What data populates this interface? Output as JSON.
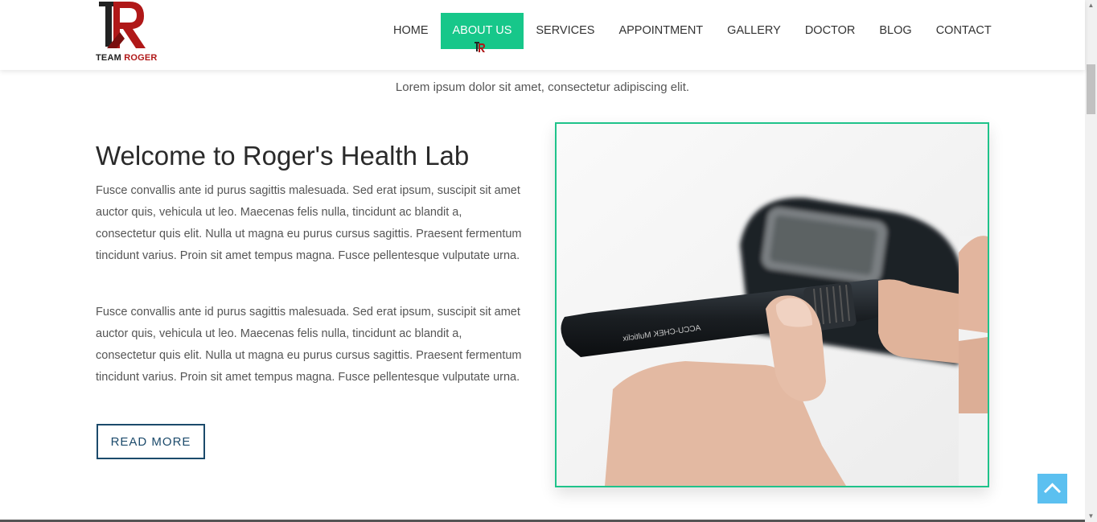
{
  "logo": {
    "text_team": "TEAM",
    "text_roger": "ROGER",
    "mark": "TR"
  },
  "nav": {
    "items": [
      {
        "label": "HOME",
        "active": false
      },
      {
        "label": "ABOUT US",
        "active": true
      },
      {
        "label": "SERVICES",
        "active": false
      },
      {
        "label": "APPOINTMENT",
        "active": false
      },
      {
        "label": "GALLERY",
        "active": false
      },
      {
        "label": "DOCTOR",
        "active": false
      },
      {
        "label": "BLOG",
        "active": false
      },
      {
        "label": "CONTACT",
        "active": false
      }
    ]
  },
  "main": {
    "subtitle": "Lorem ipsum dolor sit amet, consectetur adipiscing elit.",
    "title": "Welcome to Roger's Health Lab",
    "paragraph1": "Fusce convallis ante id purus sagittis malesuada. Sed erat ipsum, suscipit sit amet auctor quis, vehicula ut leo. Maecenas felis nulla, tincidunt ac blandit a, consectetur quis elit. Nulla ut magna eu purus cursus sagittis. Praesent fermentum tincidunt varius. Proin sit amet tempus magna. Fusce pellentesque vulputate urna.",
    "paragraph2": "Fusce convallis ante id purus sagittis malesuada. Sed erat ipsum, suscipit sit amet auctor quis, vehicula ut leo. Maecenas felis nulla, tincidunt ac blandit a, consectetur quis elit. Nulla ut magna eu purus cursus sagittis. Praesent fermentum tincidunt varius. Proin sit amet tempus magna. Fusce pellentesque vulputate urna.",
    "read_more_label": "READ MORE",
    "image_device_text": "ACCU-CHEK Multiclix"
  },
  "colors": {
    "accent_green": "#17c78a",
    "button_blue": "#1b4a6b",
    "back_to_top": "#5bc0f0",
    "logo_red": "#b01818"
  },
  "icons": {
    "back_to_top": "chevron-up-icon",
    "cursor": "logo-cursor-icon"
  }
}
